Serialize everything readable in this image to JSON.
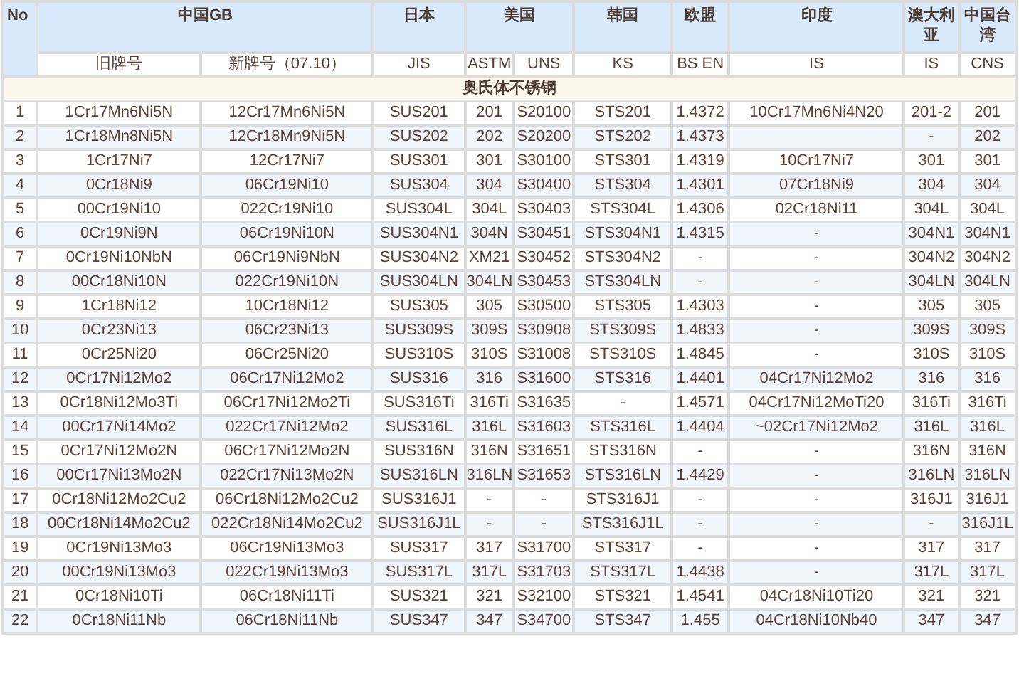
{
  "table": {
    "no_label": "No",
    "groups": [
      {
        "label": "中国GB",
        "columns": [
          "旧牌号",
          "新牌号（07.10）"
        ]
      },
      {
        "label": "日本",
        "columns": [
          "JIS"
        ]
      },
      {
        "label": "美国",
        "columns": [
          "ASTM",
          "UNS"
        ]
      },
      {
        "label": "韩国",
        "columns": [
          "KS"
        ]
      },
      {
        "label": "欧盟",
        "columns": [
          "BS EN"
        ]
      },
      {
        "label": "印度",
        "columns": [
          "IS"
        ]
      },
      {
        "label": "澳大利亚",
        "columns": [
          "IS"
        ]
      },
      {
        "label": "中国台湾",
        "columns": [
          "CNS"
        ]
      }
    ],
    "section": "奥氏体不锈钢",
    "rows": [
      [
        "1",
        "1Cr17Mn6Ni5N",
        "12Cr17Mn6Ni5N",
        "SUS201",
        "201",
        "S20100",
        "STS201",
        "1.4372",
        "10Cr17Mn6Ni4N20",
        "201-2",
        "201"
      ],
      [
        "2",
        "1Cr18Mn8Ni5N",
        "12Cr18Mn9Ni5N",
        "SUS202",
        "202",
        "S20200",
        "STS202",
        "1.4373",
        null,
        "-",
        "202"
      ],
      [
        "3",
        "1Cr17Ni7",
        "12Cr17Ni7",
        "SUS301",
        "301",
        "S30100",
        "STS301",
        "1.4319",
        "10Cr17Ni7",
        "301",
        "301"
      ],
      [
        "4",
        "0Cr18Ni9",
        "06Cr19Ni10",
        "SUS304",
        "304",
        "S30400",
        "STS304",
        "1.4301",
        "07Cr18Ni9",
        "304",
        "304"
      ],
      [
        "5",
        "00Cr19Ni10",
        "022Cr19Ni10",
        "SUS304L",
        "304L",
        "S30403",
        "STS304L",
        "1.4306",
        "02Cr18Ni11",
        "304L",
        "304L"
      ],
      [
        "6",
        "0Cr19Ni9N",
        "06Cr19Ni10N",
        "SUS304N1",
        "304N",
        "S30451",
        "STS304N1",
        "1.4315",
        "-",
        "304N1",
        "304N1"
      ],
      [
        "7",
        "0Cr19Ni10NbN",
        "06Cr19Ni9NbN",
        "SUS304N2",
        "XM21",
        "S30452",
        "STS304N2",
        "-",
        "-",
        "304N2",
        "304N2"
      ],
      [
        "8",
        "00Cr18Ni10N",
        "022Cr19Ni10N",
        "SUS304LN",
        "304LN",
        "S30453",
        "STS304LN",
        "-",
        "-",
        "304LN",
        "304LN"
      ],
      [
        "9",
        "1Cr18Ni12",
        "10Cr18Ni12",
        "SUS305",
        "305",
        "S30500",
        "STS305",
        "1.4303",
        "-",
        "305",
        "305"
      ],
      [
        "10",
        "0Cr23Ni13",
        "06Cr23Ni13",
        "SUS309S",
        "309S",
        "S30908",
        "STS309S",
        "1.4833",
        "-",
        "309S",
        "309S"
      ],
      [
        "11",
        "0Cr25Ni20",
        "06Cr25Ni20",
        "SUS310S",
        "310S",
        "S31008",
        "STS310S",
        "1.4845",
        "-",
        "310S",
        "310S"
      ],
      [
        "12",
        "0Cr17Ni12Mo2",
        "06Cr17Ni12Mo2",
        "SUS316",
        "316",
        "S31600",
        "STS316",
        "1.4401",
        "04Cr17Ni12Mo2",
        "316",
        "316"
      ],
      [
        "13",
        "0Cr18Ni12Mo3Ti",
        "06Cr17Ni12Mo2Ti",
        "SUS316Ti",
        "316Ti",
        "S31635",
        "-",
        "1.4571",
        "04Cr17Ni12MoTi20",
        "316Ti",
        "316Ti"
      ],
      [
        "14",
        "00Cr17Ni14Mo2",
        "022Cr17Ni12Mo2",
        "SUS316L",
        "316L",
        "S31603",
        "STS316L",
        "1.4404",
        "~02Cr17Ni12Mo2",
        "316L",
        "316L"
      ],
      [
        "15",
        "0Cr17Ni12Mo2N",
        "06Cr17Ni12Mo2N",
        "SUS316N",
        "316N",
        "S31651",
        "STS316N",
        "-",
        "-",
        "316N",
        "316N"
      ],
      [
        "16",
        "00Cr17Ni13Mo2N",
        "022Cr17Ni13Mo2N",
        "SUS316LN",
        "316LN",
        "S31653",
        "STS316LN",
        "1.4429",
        "-",
        "316LN",
        "316LN"
      ],
      [
        "17",
        "0Cr18Ni12Mo2Cu2",
        "06Cr18Ni12Mo2Cu2",
        "SUS316J1",
        "-",
        "-",
        "STS316J1",
        "-",
        "-",
        "316J1",
        "316J1"
      ],
      [
        "18",
        "00Cr18Ni14Mo2Cu2",
        "022Cr18Ni14Mo2Cu2",
        "SUS316J1L",
        "-",
        "-",
        "STS316J1L",
        "-",
        "-",
        "-",
        "316J1L"
      ],
      [
        "19",
        "0Cr19Ni13Mo3",
        "06Cr19Ni13Mo3",
        "SUS317",
        "317",
        "S31700",
        "STS317",
        "-",
        "-",
        "317",
        "317"
      ],
      [
        "20",
        "00Cr19Ni13Mo3",
        "022Cr19Ni13Mo3",
        "SUS317L",
        "317L",
        "S31703",
        "STS317L",
        "1.4438",
        "-",
        "317L",
        "317L"
      ],
      [
        "21",
        "0Cr18Ni10Ti",
        "06Cr18Ni11Ti",
        "SUS321",
        "321",
        "S32100",
        "STS321",
        "1.4541",
        "04Cr18Ni10Ti20",
        "321",
        "321"
      ],
      [
        "22",
        "0Cr18Ni11Nb",
        "06Cr18Ni11Nb",
        "SUS347",
        "347",
        "S34700",
        "STS347",
        "1.455",
        "04Cr18Ni10Nb40",
        "347",
        "347"
      ]
    ]
  }
}
